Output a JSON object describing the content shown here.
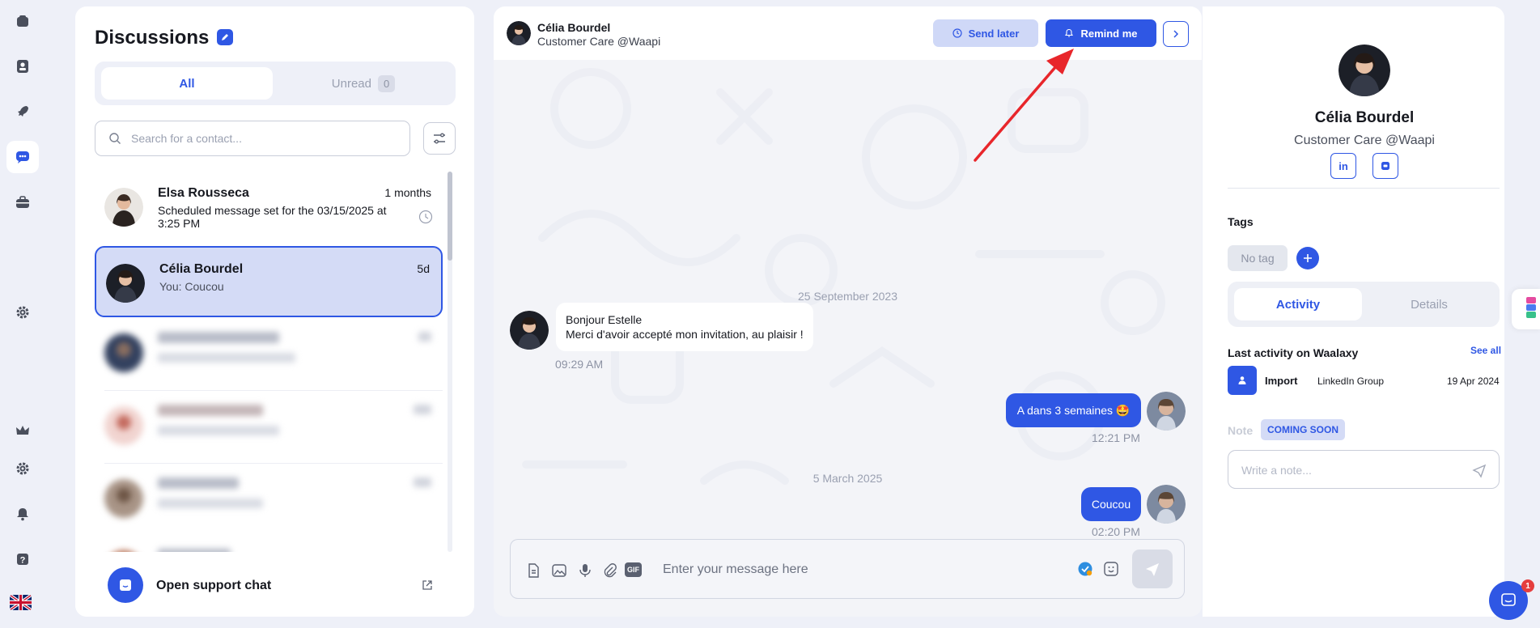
{
  "rail": {
    "items": [
      {
        "icon": "home-icon"
      },
      {
        "icon": "contacts-icon"
      },
      {
        "icon": "rocket-icon"
      },
      {
        "icon": "chat-icon",
        "active": true
      },
      {
        "icon": "briefcase-icon"
      },
      {
        "icon": "gear-icon"
      },
      {
        "icon": "crown-icon"
      },
      {
        "icon": "settings-icon"
      },
      {
        "icon": "bell-icon"
      },
      {
        "icon": "help-icon"
      }
    ],
    "language_flag": "uk-flag-icon"
  },
  "discussions": {
    "title": "Discussions",
    "tabs": {
      "all": "All",
      "unread": "Unread",
      "unread_count": "0"
    },
    "search_placeholder": "Search for a contact...",
    "conversations": [
      {
        "name": "Elsa Rousseca",
        "time": "1 months",
        "preview": "Scheduled message set for the 03/15/2025 at 3:25 PM"
      },
      {
        "name": "Célia Bourdel",
        "time": "5d",
        "preview": "You: Coucou"
      }
    ],
    "support_label": "Open support chat"
  },
  "chat": {
    "contact_name": "Célia Bourdel",
    "contact_subtitle": "Customer Care @Waapi",
    "send_later": "Send later",
    "remind_me": "Remind me",
    "date1": "25 September 2023",
    "incoming_line1": "Bonjour Estelle",
    "incoming_line2": "Merci d'avoir accepté mon invitation, au plaisir !",
    "incoming_time": "09:29 AM",
    "outgoing1": "A dans 3 semaines 🤩",
    "outgoing1_time": "12:21 PM",
    "date2": "5 March 2025",
    "outgoing2": "Coucou",
    "outgoing2_time": "02:20 PM",
    "composer_placeholder": "Enter your message here",
    "gif_label": "GIF"
  },
  "profile": {
    "name": "Célia Bourdel",
    "subtitle": "Customer Care @Waapi",
    "linkedin_label": "in",
    "tags_title": "Tags",
    "no_tag": "No tag",
    "tabs": {
      "activity": "Activity",
      "details": "Details"
    },
    "last_activity_title": "Last activity on Waalaxy",
    "see_all": "See all",
    "activity": {
      "type": "Import",
      "source": "LinkedIn Group",
      "date": "19 Apr 2024"
    },
    "note_label": "Note",
    "coming_soon": "COMING SOON",
    "note_placeholder": "Write a note..."
  },
  "intercom_badge": "1",
  "colors": {
    "accent": "#2f57e4",
    "annotation_arrow": "#e8262b"
  }
}
